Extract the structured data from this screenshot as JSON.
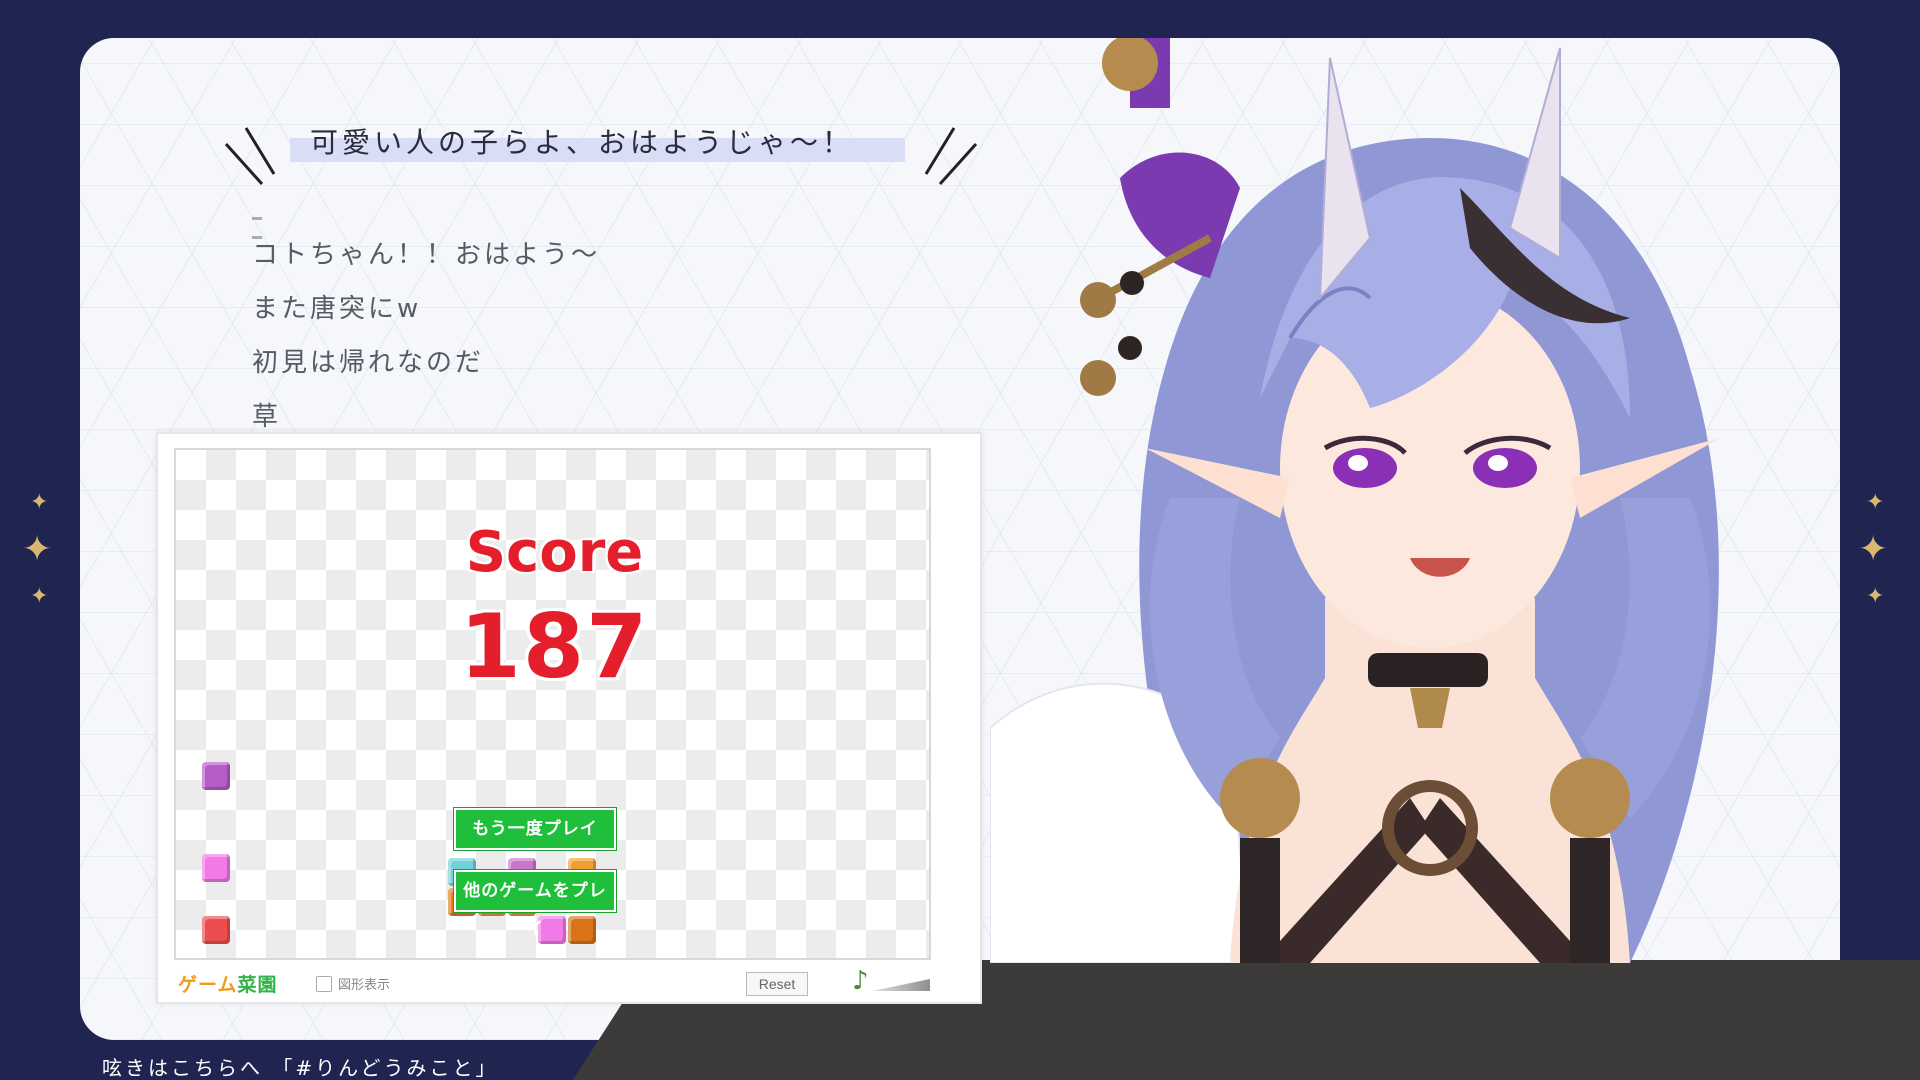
{
  "header": {
    "message": "可愛い人の子らよ、おはようじゃ〜！"
  },
  "chat": {
    "messages": [
      "コトちゃん！！おはよう〜",
      "また唐突にw",
      "初見は帰れなのだ",
      "草"
    ]
  },
  "game": {
    "score_label": "Score",
    "score_value": "187",
    "buttons": {
      "play_again": "もう一度プレイ",
      "other_games": "他のゲームをプレイ"
    },
    "footer": {
      "logo_part1": "ゲーム",
      "logo_part2": "菜園",
      "shape_display_label": "図形表示",
      "shape_display_checked": false,
      "reset_label": "Reset",
      "sound_icon": "music-note-icon",
      "volume_level": 0.6
    },
    "block_colors": {
      "purple": "#b65cc8",
      "pink": "#f27ae6",
      "red": "#ec4e4e",
      "orange": "#e67e22",
      "cyan": "#6fd3d9"
    }
  },
  "caption": {
    "text": "呟きはこちらへ 「#りんどうみこと」"
  },
  "colors": {
    "background": "#1f2550",
    "accent_red": "#e41f2b",
    "button_green": "#1fbf3c",
    "sparkle": "#d8b870",
    "hair": "#9aa2dc"
  }
}
